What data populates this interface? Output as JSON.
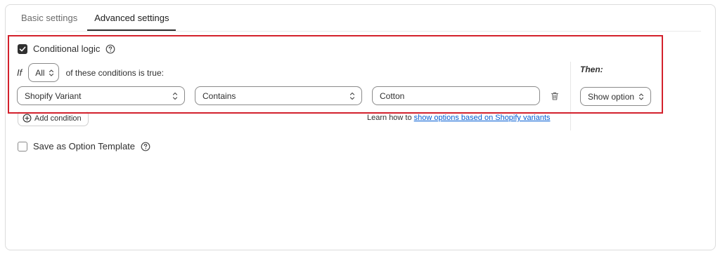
{
  "tabs": [
    {
      "label": "Basic settings",
      "active": false
    },
    {
      "label": "Advanced settings",
      "active": true
    }
  ],
  "conditional_logic": {
    "label": "Conditional logic",
    "checked": true,
    "help_icon": "question-circle-icon"
  },
  "rule": {
    "if_label": "If",
    "match_select": "All",
    "conditions_text": "of these conditions is true:",
    "condition": {
      "field": "Shopify Variant",
      "operator": "Contains",
      "value": "Cotton",
      "delete_icon": "trash-icon"
    },
    "add_condition_label": "Add condition",
    "learn_prefix": "Learn how to ",
    "learn_link": "show options based on Shopify variants"
  },
  "then": {
    "label": "Then:",
    "action_select": "Show option"
  },
  "save_template": {
    "label": "Save as Option Template",
    "checked": false
  },
  "colors": {
    "highlight": "#d3212c",
    "link": "#005bd3",
    "checkbox_checked": "#303030"
  }
}
